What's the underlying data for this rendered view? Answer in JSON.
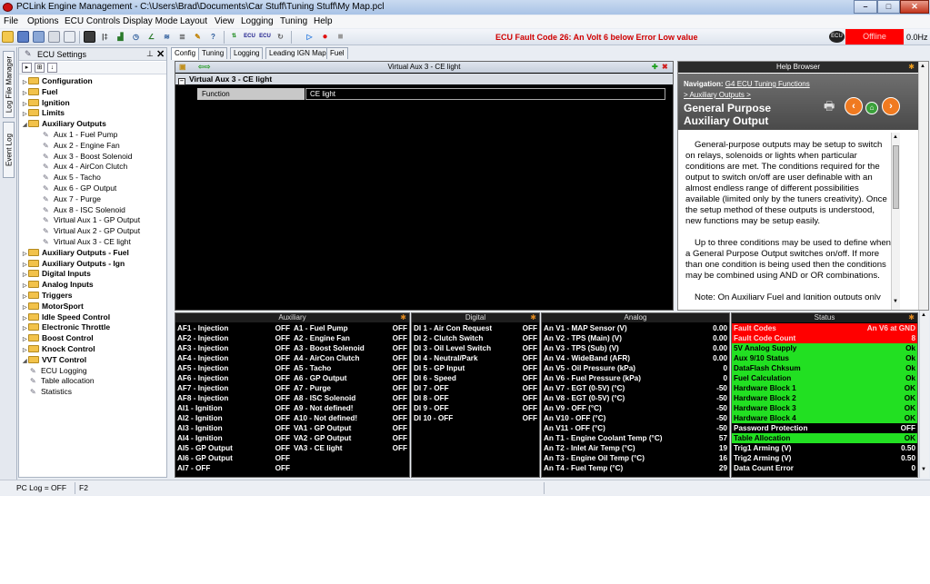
{
  "window": {
    "title": "PCLink Engine Management - C:\\Users\\Brad\\Documents\\Car Stuff\\Tuning Stuff\\My Map.pcl",
    "buttons": {
      "minimize": "–",
      "maximize": "□",
      "close": "✕"
    }
  },
  "menu": [
    "File",
    "Options",
    "ECU Controls",
    "Display Mode",
    "Layout",
    "View",
    "Logging",
    "Tuning",
    "Help"
  ],
  "toolbar": {
    "fault_message": "ECU Fault Code 26: An Volt 6 below Error Low value",
    "ecu_chip": "ECU",
    "connection_status": "Offline",
    "rate": "0.0Hz",
    "status_color": "#ff0000",
    "fault_color": "#d00000"
  },
  "side_tabs": [
    "Log File Manager",
    "Event Log"
  ],
  "settings_panel": {
    "title": "ECU Settings",
    "pin_icon": "pin-icon",
    "close_label": "✕",
    "tools": [
      "grid-view-icon",
      "sort-az-icon"
    ],
    "items": [
      {
        "label": "Configuration",
        "type": "folder",
        "depth": 0
      },
      {
        "label": "Fuel",
        "type": "folder",
        "depth": 0
      },
      {
        "label": "Ignition",
        "type": "folder",
        "depth": 0
      },
      {
        "label": "Limits",
        "type": "folder",
        "depth": 0
      },
      {
        "label": "Auxiliary Outputs",
        "type": "folder-open",
        "depth": 0
      },
      {
        "label": "Aux   1 - Fuel Pump",
        "type": "leaf",
        "depth": 1
      },
      {
        "label": "Aux   2 - Engine Fan",
        "type": "leaf",
        "depth": 1
      },
      {
        "label": "Aux   3 - Boost Solenoid",
        "type": "leaf",
        "depth": 1
      },
      {
        "label": "Aux   4 - AirCon Clutch",
        "type": "leaf",
        "depth": 1
      },
      {
        "label": "Aux   5 - Tacho",
        "type": "leaf",
        "depth": 1
      },
      {
        "label": "Aux   6 - GP Output",
        "type": "leaf",
        "depth": 1
      },
      {
        "label": "Aux   7 - Purge",
        "type": "leaf",
        "depth": 1
      },
      {
        "label": "Aux   8 - ISC Solenoid",
        "type": "leaf",
        "depth": 1
      },
      {
        "label": "Virtual Aux  1 - GP Output",
        "type": "leaf",
        "depth": 1
      },
      {
        "label": "Virtual Aux  2 - GP Output",
        "type": "leaf",
        "depth": 1
      },
      {
        "label": "Virtual Aux  3 - CE light",
        "type": "leaf",
        "depth": 1
      },
      {
        "label": "Auxiliary Outputs - Fuel",
        "type": "folder",
        "depth": 0
      },
      {
        "label": "Auxiliary Outputs - Ign",
        "type": "folder",
        "depth": 0
      },
      {
        "label": "Digital Inputs",
        "type": "folder",
        "depth": 0
      },
      {
        "label": "Analog Inputs",
        "type": "folder",
        "depth": 0
      },
      {
        "label": "Triggers",
        "type": "folder",
        "depth": 0
      },
      {
        "label": "MotorSport",
        "type": "folder",
        "depth": 0
      },
      {
        "label": "Idle Speed Control",
        "type": "folder",
        "depth": 0
      },
      {
        "label": "Electronic Throttle",
        "type": "folder",
        "depth": 0
      },
      {
        "label": "Boost Control",
        "type": "folder",
        "depth": 0
      },
      {
        "label": "Knock Control",
        "type": "folder",
        "depth": 0
      },
      {
        "label": "VVT Control",
        "type": "folder-open",
        "depth": 0
      },
      {
        "label": "ECU Logging",
        "type": "leaf",
        "depth": 0
      },
      {
        "label": "Table allocation",
        "type": "leaf",
        "depth": 0
      },
      {
        "label": "Statistics",
        "type": "leaf",
        "depth": 0
      }
    ]
  },
  "tabs": [
    "Config",
    "Tuning",
    "Logging",
    "Leading IGN Map",
    "Fuel"
  ],
  "active_tab": "Config",
  "config": {
    "header": "Virtual Aux  3 - CE light",
    "section": "Virtual Aux  3 - CE light",
    "toggle": "–",
    "field_label": "Function",
    "field_value": "CE light"
  },
  "help": {
    "title": "Help Browser",
    "nav_label": "Navigation:",
    "nav_link": "G4 ECU Tuning Functions",
    "nav_sub": "> Auxiliary Outputs >",
    "topic": "General Purpose Auxiliary Output",
    "paragraphs": [
      "General-purpose outputs may be setup to switch on relays, solenoids or lights when particular conditions are met.  The conditions required for the output to switch on/off are user definable with an almost endless range of different possibilities available (limited only by the tuners creativity).  Once the setup method of these outputs is understood, new functions may be setup easily.",
      "Up to three conditions may be used to define when a General Purpose Output switches on/off.  If more than one condition is being used then the conditions may be combined using AND or OR combinations.",
      "Note: On Auxiliary Fuel and Ignition outputs only"
    ]
  },
  "runtime": {
    "auxiliary": {
      "title": "Auxiliary",
      "left": [
        [
          "AF1 - Injection",
          "OFF"
        ],
        [
          "AF2 - Injection",
          "OFF"
        ],
        [
          "AF3 - Injection",
          "OFF"
        ],
        [
          "AF4 - Injection",
          "OFF"
        ],
        [
          "AF5 - Injection",
          "OFF"
        ],
        [
          "AF6 - Injection",
          "OFF"
        ],
        [
          "AF7 - Injection",
          "OFF"
        ],
        [
          "AF8 - Injection",
          "OFF"
        ],
        [
          "AI1 - Ignition",
          "OFF"
        ],
        [
          "AI2 - Ignition",
          "OFF"
        ],
        [
          "AI3 - Ignition",
          "OFF"
        ],
        [
          "AI4 - Ignition",
          "OFF"
        ],
        [
          "AI5 - GP Output",
          "OFF"
        ],
        [
          "AI6 - GP Output",
          "OFF"
        ],
        [
          "AI7 - OFF",
          "OFF"
        ]
      ],
      "right": [
        [
          "A1 - Fuel Pump",
          "OFF"
        ],
        [
          "A2 - Engine Fan",
          "OFF"
        ],
        [
          "A3 - Boost Solenoid",
          "OFF"
        ],
        [
          "A4 - AirCon Clutch",
          "OFF"
        ],
        [
          "A5 - Tacho",
          "OFF"
        ],
        [
          "A6 - GP Output",
          "OFF"
        ],
        [
          "A7 - Purge",
          "OFF"
        ],
        [
          "A8 - ISC Solenoid",
          "OFF"
        ],
        [
          "A9 - Not defined!",
          "OFF"
        ],
        [
          "A10 - Not defined!",
          "OFF"
        ],
        [
          "VA1 - GP Output",
          "OFF"
        ],
        [
          "VA2 - GP Output",
          "OFF"
        ],
        [
          "VA3 - CE light",
          "OFF"
        ]
      ]
    },
    "digital": {
      "title": "Digital",
      "rows": [
        [
          "DI 1 - Air Con Request",
          "OFF"
        ],
        [
          "DI 2 - Clutch Switch",
          "OFF"
        ],
        [
          "DI 3 - Oil Level Switch",
          "OFF"
        ],
        [
          "DI 4 - Neutral/Park",
          "OFF"
        ],
        [
          "DI 5 - GP Input",
          "OFF"
        ],
        [
          "DI 6 - Speed",
          "OFF"
        ],
        [
          "DI 7 - OFF",
          "OFF"
        ],
        [
          "DI 8 - OFF",
          "OFF"
        ],
        [
          "DI 9 - OFF",
          "OFF"
        ],
        [
          "DI 10 - OFF",
          "OFF"
        ]
      ]
    },
    "analog": {
      "title": "Analog",
      "rows": [
        [
          "An V1 - MAP Sensor (V)",
          "0.00"
        ],
        [
          "An V2 - TPS (Main) (V)",
          "0.00"
        ],
        [
          "An V3 - TPS (Sub) (V)",
          "0.00"
        ],
        [
          "An V4 - WideBand (AFR)",
          "0.00"
        ],
        [
          "An V5 - Oil Pressure (kPa)",
          "0"
        ],
        [
          "An V6 - Fuel Pressure (kPa)",
          "0"
        ],
        [
          "An V7 - EGT (0-5V) (°C)",
          "-50"
        ],
        [
          "An V8 - EGT (0-5V) (°C)",
          "-50"
        ],
        [
          "An V9 - OFF (°C)",
          "-50"
        ],
        [
          "An V10 - OFF (°C)",
          "-50"
        ],
        [
          "An V11 - OFF (°C)",
          "-50"
        ],
        [
          "An T1 - Engine Coolant Temp (°C)",
          "57"
        ],
        [
          "An T2 - Inlet Air Temp (°C)",
          "19"
        ],
        [
          "An T3 - Engine Oil Temp (°C)",
          "16"
        ],
        [
          "An T4 - Fuel Temp (°C)",
          "29"
        ]
      ]
    },
    "status": {
      "title": "Status",
      "rows": [
        {
          "name": "Fault Codes",
          "value": "An V6 at GND",
          "state": "red"
        },
        {
          "name": "Fault Code Count",
          "value": "8",
          "state": "red"
        },
        {
          "name": "5V Analog Supply",
          "value": "Ok",
          "state": "green"
        },
        {
          "name": "Aux 9/10 Status",
          "value": "Ok",
          "state": "green"
        },
        {
          "name": "DataFlash Chksum",
          "value": "Ok",
          "state": "green"
        },
        {
          "name": "Fuel Calculation",
          "value": "Ok",
          "state": "green"
        },
        {
          "name": "Hardware Block 1",
          "value": "OK",
          "state": "green"
        },
        {
          "name": "Hardware Block 2",
          "value": "OK",
          "state": "green"
        },
        {
          "name": "Hardware Block 3",
          "value": "OK",
          "state": "green"
        },
        {
          "name": "Hardware Block 4",
          "value": "OK",
          "state": "green"
        },
        {
          "name": "Password Protection",
          "value": "OFF",
          "state": "black"
        },
        {
          "name": "Table Allocation",
          "value": "OK",
          "state": "green"
        },
        {
          "name": "Trig1 Arming (V)",
          "value": "0.50",
          "state": "black"
        },
        {
          "name": "Trig2 Arming (V)",
          "value": "0.50",
          "state": "black"
        },
        {
          "name": "Data Count Error",
          "value": "0",
          "state": "black"
        }
      ]
    }
  },
  "statusbar": {
    "pc_log": "PC Log = OFF",
    "key": "F2"
  }
}
